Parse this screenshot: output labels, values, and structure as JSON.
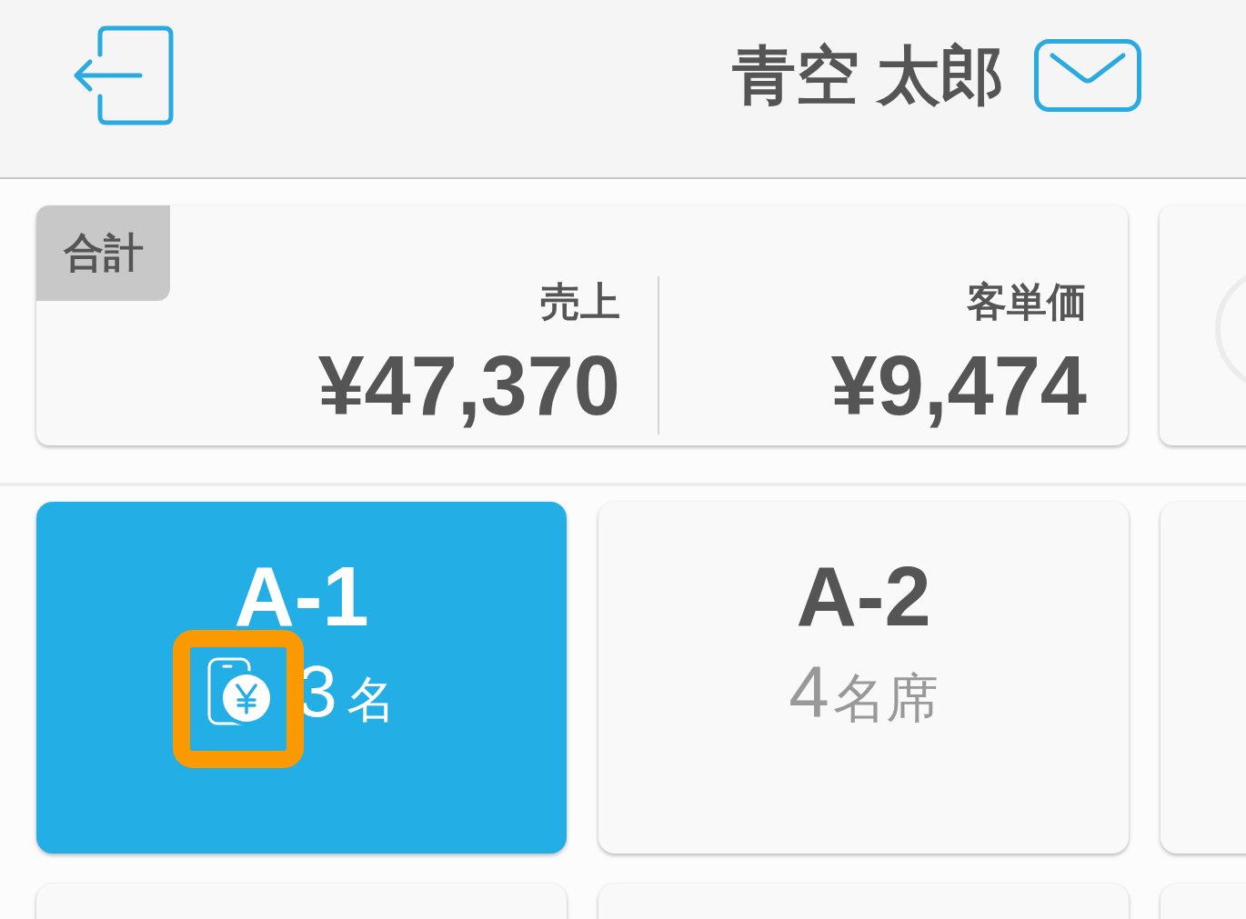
{
  "header": {
    "user_name": "青空 太郎"
  },
  "summary": {
    "tag": "合計",
    "metrics": [
      {
        "label": "売上",
        "value": "¥47,370"
      },
      {
        "label": "客単価",
        "value": "¥9,474"
      }
    ]
  },
  "tables": [
    {
      "label": "A-1",
      "occupied": true,
      "highlighted": true,
      "count": "3",
      "unit": "名"
    },
    {
      "label": "A-2",
      "occupied": false,
      "highlighted": false,
      "count": "4",
      "unit": "名席"
    },
    {
      "occupied": false,
      "highlighted": false
    },
    {
      "occupied": false,
      "highlighted": false
    },
    {
      "occupied": false,
      "highlighted": false
    },
    {
      "occupied": false,
      "highlighted": false
    }
  ]
}
